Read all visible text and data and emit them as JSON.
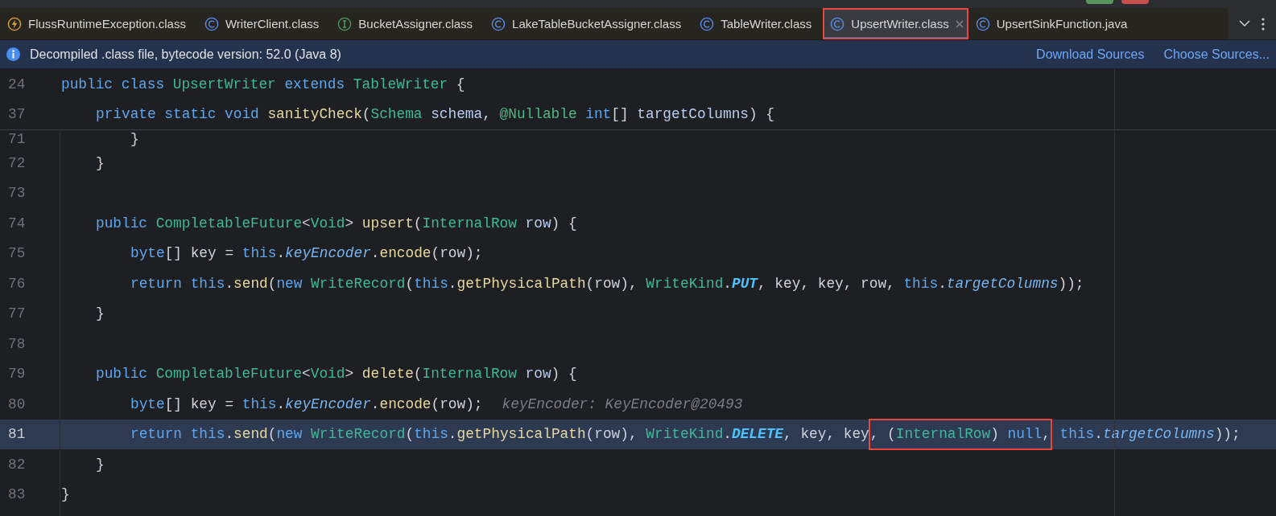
{
  "tabs": [
    {
      "label": "FlussRuntimeException.class",
      "kind": "exception",
      "selected": false,
      "boxed": false
    },
    {
      "label": "WriterClient.class",
      "kind": "class",
      "selected": false,
      "boxed": false
    },
    {
      "label": "BucketAssigner.class",
      "kind": "interface",
      "selected": false,
      "boxed": false
    },
    {
      "label": "LakeTableBucketAssigner.class",
      "kind": "class",
      "selected": false,
      "boxed": false
    },
    {
      "label": "TableWriter.class",
      "kind": "class",
      "selected": false,
      "boxed": false
    },
    {
      "label": "UpsertWriter.class",
      "kind": "class",
      "selected": true,
      "boxed": true
    },
    {
      "label": "UpsertSinkFunction.java",
      "kind": "class",
      "selected": false,
      "boxed": false
    }
  ],
  "banner": {
    "message": "Decompiled .class file, bytecode version: 52.0 (Java 8)",
    "links": [
      "Download Sources",
      "Choose Sources..."
    ]
  },
  "sticky_lines": [
    {
      "number": "24",
      "current": false,
      "kind": "top",
      "tokens": [
        {
          "t": "public class ",
          "kind": "kw"
        },
        {
          "t": "UpsertWriter ",
          "kind": "type"
        },
        {
          "t": "extends ",
          "kind": "kw"
        },
        {
          "t": "TableWriter",
          "kind": "type"
        },
        {
          "t": " {",
          "kind": "plain"
        }
      ]
    },
    {
      "number": "37",
      "current": false,
      "kind": "member",
      "tokens": [
        {
          "t": "private static void ",
          "kind": "kw"
        },
        {
          "t": "sanityCheck",
          "kind": "fn"
        },
        {
          "t": "(",
          "kind": "plain"
        },
        {
          "t": "Schema ",
          "kind": "type"
        },
        {
          "t": "schema",
          "kind": "param"
        },
        {
          "t": ", ",
          "kind": "plain"
        },
        {
          "t": "@Nullable ",
          "kind": "anno"
        },
        {
          "t": "int",
          "kind": "kw"
        },
        {
          "t": "[] ",
          "kind": "plain"
        },
        {
          "t": "targetColumns",
          "kind": "param"
        },
        {
          "t": ") {",
          "kind": "plain"
        }
      ]
    }
  ],
  "lines": [
    {
      "number": "71",
      "current": false,
      "partial": true,
      "kind": "statement",
      "tokens": [
        {
          "t": "}",
          "kind": "plain"
        }
      ]
    },
    {
      "number": "72",
      "current": false,
      "kind": "member",
      "tokens": [
        {
          "t": "}",
          "kind": "plain"
        }
      ]
    },
    {
      "number": "73",
      "current": false
    },
    {
      "number": "74",
      "current": false,
      "kind": "member",
      "tokens": [
        {
          "t": "public ",
          "kind": "kw"
        },
        {
          "t": "CompletableFuture",
          "kind": "type"
        },
        {
          "t": "<",
          "kind": "plain"
        },
        {
          "t": "Void",
          "kind": "type"
        },
        {
          "t": "> ",
          "kind": "plain"
        },
        {
          "t": "upsert",
          "kind": "fn"
        },
        {
          "t": "(",
          "kind": "plain"
        },
        {
          "t": "InternalRow ",
          "kind": "type"
        },
        {
          "t": "row",
          "kind": "param"
        },
        {
          "t": ") {",
          "kind": "plain"
        }
      ]
    },
    {
      "number": "75",
      "current": false,
      "kind": "statement",
      "tokens": [
        {
          "t": "byte",
          "kind": "kw"
        },
        {
          "t": "[] key = ",
          "kind": "plain"
        },
        {
          "t": "this",
          "kind": "kw"
        },
        {
          "t": ".",
          "kind": "plain"
        },
        {
          "t": "keyEncoder",
          "kind": "field"
        },
        {
          "t": ".",
          "kind": "plain"
        },
        {
          "t": "encode",
          "kind": "fn"
        },
        {
          "t": "(row);",
          "kind": "plain"
        }
      ]
    },
    {
      "number": "76",
      "current": false,
      "kind": "statement",
      "tokens": [
        {
          "t": "return this",
          "kind": "kw"
        },
        {
          "t": ".",
          "kind": "plain"
        },
        {
          "t": "send",
          "kind": "fn"
        },
        {
          "t": "(",
          "kind": "plain"
        },
        {
          "t": "new ",
          "kind": "kw"
        },
        {
          "t": "WriteRecord",
          "kind": "type"
        },
        {
          "t": "(",
          "kind": "plain"
        },
        {
          "t": "this",
          "kind": "kw"
        },
        {
          "t": ".",
          "kind": "plain"
        },
        {
          "t": "getPhysicalPath",
          "kind": "fn"
        },
        {
          "t": "(row), ",
          "kind": "plain"
        },
        {
          "t": "WriteKind",
          "kind": "type"
        },
        {
          "t": ".",
          "kind": "plain"
        },
        {
          "t": "PUT",
          "kind": "const"
        },
        {
          "t": ", key, key, row, ",
          "kind": "plain"
        },
        {
          "t": "this",
          "kind": "kw"
        },
        {
          "t": ".",
          "kind": "plain"
        },
        {
          "t": "targetColumns",
          "kind": "field"
        },
        {
          "t": "));",
          "kind": "plain"
        }
      ]
    },
    {
      "number": "77",
      "current": false,
      "kind": "member",
      "tokens": [
        {
          "t": "}",
          "kind": "plain"
        }
      ]
    },
    {
      "number": "78",
      "current": false
    },
    {
      "number": "79",
      "current": false,
      "kind": "member",
      "tokens": [
        {
          "t": "public ",
          "kind": "kw"
        },
        {
          "t": "CompletableFuture",
          "kind": "type"
        },
        {
          "t": "<",
          "kind": "plain"
        },
        {
          "t": "Void",
          "kind": "type"
        },
        {
          "t": "> ",
          "kind": "plain"
        },
        {
          "t": "delete",
          "kind": "fn"
        },
        {
          "t": "(",
          "kind": "plain"
        },
        {
          "t": "InternalRow ",
          "kind": "type"
        },
        {
          "t": "row",
          "kind": "param"
        },
        {
          "t": ") {",
          "kind": "plain"
        }
      ]
    },
    {
      "number": "80",
      "current": false,
      "kind": "statement",
      "hint": "keyEncoder: KeyEncoder@20493",
      "tokens": [
        {
          "t": "byte",
          "kind": "kw"
        },
        {
          "t": "[] key = ",
          "kind": "plain"
        },
        {
          "t": "this",
          "kind": "kw"
        },
        {
          "t": ".",
          "kind": "plain"
        },
        {
          "t": "keyEncoder",
          "kind": "field"
        },
        {
          "t": ".",
          "kind": "plain"
        },
        {
          "t": "encode",
          "kind": "fn"
        },
        {
          "t": "(row);",
          "kind": "plain"
        }
      ]
    },
    {
      "number": "81",
      "current": true,
      "kind": "statement",
      "tokens": [
        {
          "t": "return this",
          "kind": "kw"
        },
        {
          "t": ".",
          "kind": "plain"
        },
        {
          "t": "send",
          "kind": "fn"
        },
        {
          "t": "(",
          "kind": "plain"
        },
        {
          "t": "new ",
          "kind": "kw"
        },
        {
          "t": "WriteRecord",
          "kind": "type"
        },
        {
          "t": "(",
          "kind": "plain"
        },
        {
          "t": "this",
          "kind": "kw"
        },
        {
          "t": ".",
          "kind": "plain"
        },
        {
          "t": "getPhysicalPath",
          "kind": "fn"
        },
        {
          "t": "(row), ",
          "kind": "plain"
        },
        {
          "t": "WriteKind",
          "kind": "type"
        },
        {
          "t": ".",
          "kind": "plain"
        },
        {
          "t": "DELETE",
          "kind": "const"
        },
        {
          "t": ", key, key",
          "kind": "plain"
        },
        {
          "t": ", (",
          "kind": "plain",
          "boxed": true
        },
        {
          "t": "InternalRow",
          "kind": "type",
          "boxed": true
        },
        {
          "t": ") ",
          "kind": "plain",
          "boxed": true
        },
        {
          "t": "null",
          "kind": "kw",
          "boxed": true
        },
        {
          "t": ",",
          "kind": "plain",
          "boxed": true
        },
        {
          "t": " this",
          "kind": "kw"
        },
        {
          "t": ".",
          "kind": "plain"
        },
        {
          "t": "targetColumns",
          "kind": "field"
        },
        {
          "t": "));",
          "kind": "plain"
        }
      ]
    },
    {
      "number": "82",
      "current": false,
      "kind": "member",
      "tokens": [
        {
          "t": "}",
          "kind": "plain"
        }
      ]
    },
    {
      "number": "83",
      "current": false,
      "kind": "top",
      "tokens": [
        {
          "t": "}",
          "kind": "plain"
        }
      ]
    }
  ]
}
